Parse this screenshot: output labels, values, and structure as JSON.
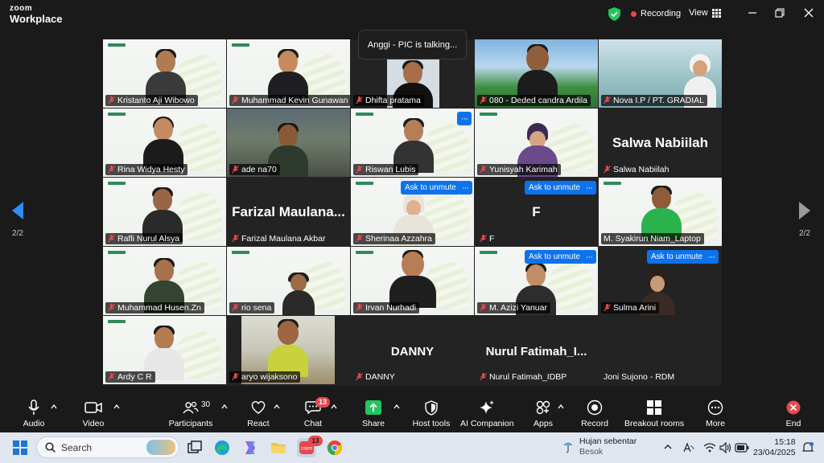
{
  "app": {
    "brand_line1": "zoom",
    "brand_line2": "Workplace"
  },
  "header": {
    "recording_label": "Recording",
    "view_label": "View"
  },
  "talking_banner": "Anggi - PIC is talking...",
  "pager": {
    "left_label": "2/2",
    "right_label": "2/2"
  },
  "participants": [
    {
      "name": "Kristanto Aji Wibowo"
    },
    {
      "name": "Muhammad Kevin Gunawan"
    },
    {
      "name": "Dhifta pratama"
    },
    {
      "name": "080 - Deded candra Ardila"
    },
    {
      "name": "Nova I.P / PT. GRADIAL"
    },
    {
      "name": "Rina Widya Hesty"
    },
    {
      "name": "ade na70"
    },
    {
      "name": "Riswan Lubis"
    },
    {
      "name": "Yunisyah Karimah"
    },
    {
      "name": "Salwa Nabiilah",
      "display": "Salwa Nabiilah"
    },
    {
      "name": "Rafli Nurul Alsya"
    },
    {
      "name": "Farizal Maulana Akbar",
      "display": "Farizal  Maulana..."
    },
    {
      "name": "Sherinaa Azzahra",
      "ask_unmute": "Ask to unmute"
    },
    {
      "name": "F",
      "display": "F",
      "ask_unmute": "Ask to unmute"
    },
    {
      "name": "M. Syakirun Niam_Laptop"
    },
    {
      "name": "Muhammad Husen.Zn"
    },
    {
      "name": "rio sena"
    },
    {
      "name": "Irvan Nurhadi"
    },
    {
      "name": "M. Azizi Yanuar",
      "ask_unmute": "Ask to unmute"
    },
    {
      "name": "Sulma Arini",
      "ask_unmute": "Ask to unmute"
    },
    {
      "name": "Ardy C R"
    },
    {
      "name": "aryo wijaksono"
    },
    {
      "name": "DANNY",
      "display": "DANNY"
    },
    {
      "name": "Nurul Fatimah_IDBP",
      "display": "Nurul  Fatimah_I..."
    },
    {
      "name": "Joni Sujono - RDM"
    }
  ],
  "more_label": "···",
  "toolbar": {
    "audio": "Audio",
    "video": "Video",
    "participants": "Participants",
    "participants_count": "30",
    "react": "React",
    "chat": "Chat",
    "chat_badge": "13",
    "share": "Share",
    "host_tools": "Host tools",
    "ai_companion": "AI Companion",
    "apps": "Apps",
    "record": "Record",
    "breakout_rooms": "Breakout rooms",
    "more": "More",
    "end": "End"
  },
  "taskbar": {
    "search_placeholder": "Search",
    "zoom_badge": "13",
    "weather_title": "Hujan sebentar",
    "weather_sub": "Besok",
    "time": "15:18",
    "date": "23/04/2025"
  },
  "colors": {
    "accent": "#0e72ed",
    "share_green": "#23c55e",
    "end_red": "#e5484d"
  }
}
